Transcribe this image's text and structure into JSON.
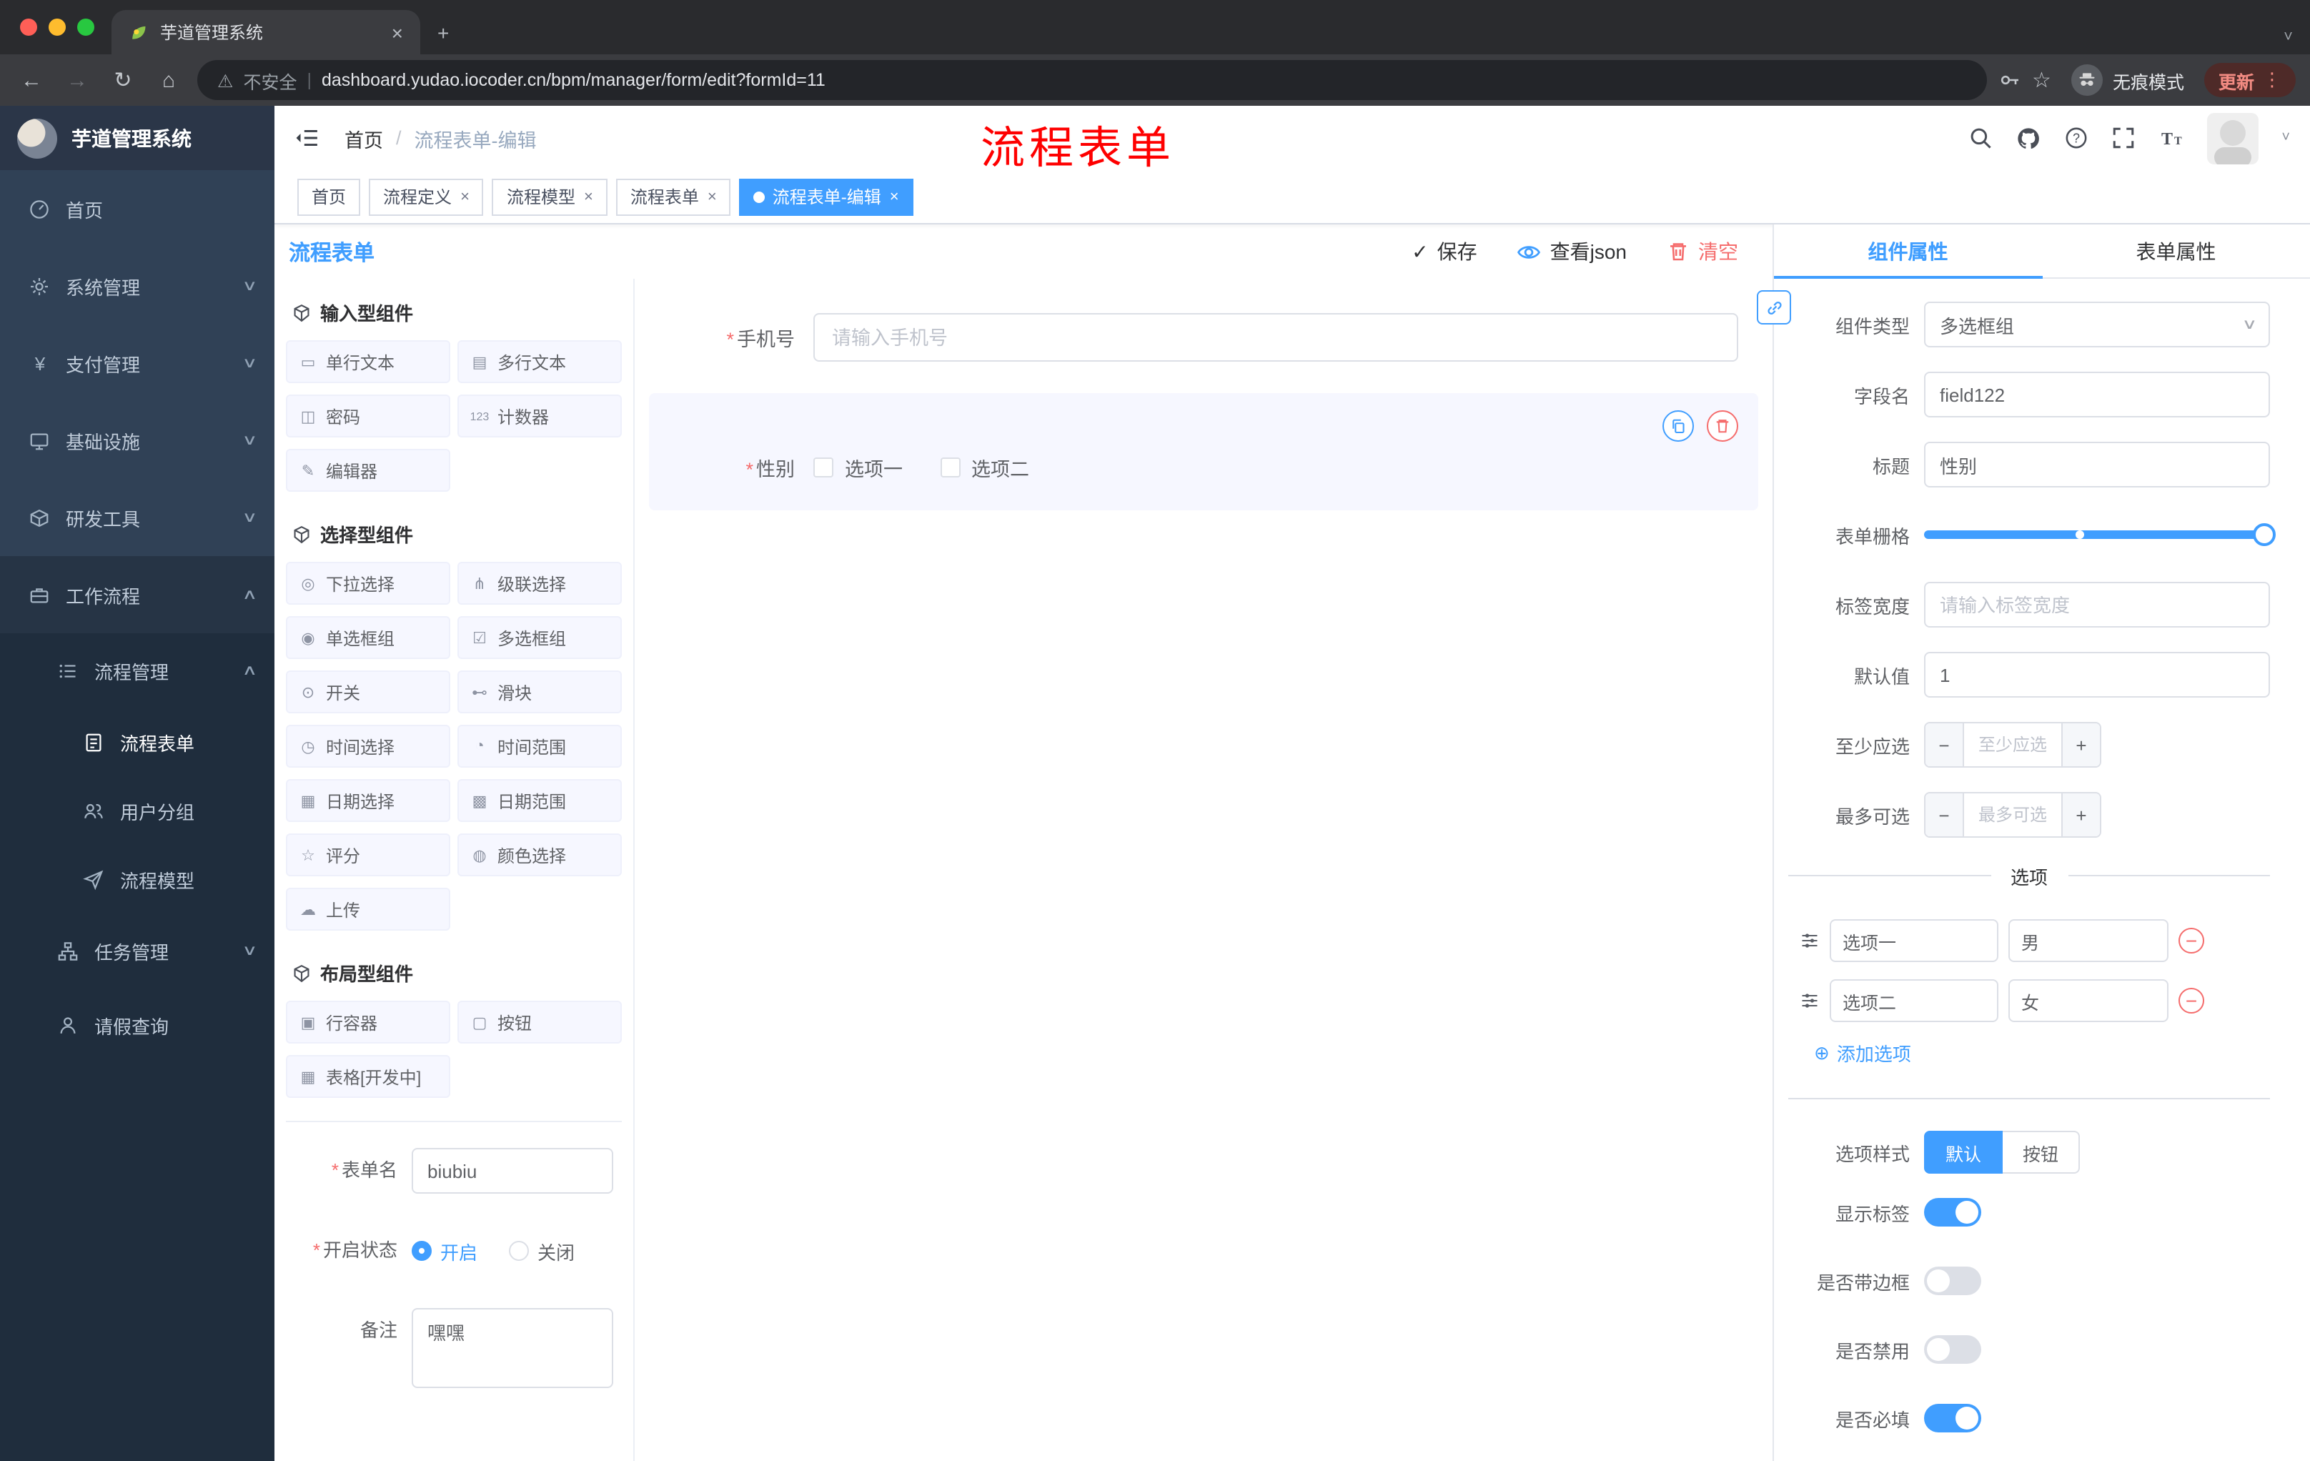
{
  "colors": {
    "primary": "#409eff",
    "danger": "#f56c6c",
    "sidebar_bg": "#304156",
    "sidebar_submenu_bg": "#1f2d3d",
    "nav_tab_active_bg": "#409eff",
    "annotation_red": "#fe0000",
    "update_pill_red": "#f28b82"
  },
  "icons": {
    "close": "×",
    "new_tab": "+",
    "back": "←",
    "forward": "→",
    "reload": "↻",
    "home": "⌂",
    "warning": "⚠",
    "star": "☆",
    "menu_dots": "⋮",
    "caret_down": "˅",
    "divider": "|",
    "check": "✓",
    "slash": "/",
    "chev_down": "∨",
    "chev_up": "∧",
    "required": "*",
    "minus": "−",
    "plus": "+",
    "add_circle": "⊕",
    "yen": "¥"
  },
  "browser": {
    "tab_title": "芋道管理系统",
    "security_label": "不安全",
    "url": "dashboard.yudao.iocoder.cn/bpm/manager/form/edit?formId=11",
    "incognito_label": "无痕模式",
    "update_label": "更新"
  },
  "annotation": {
    "text": "流程表单"
  },
  "app_header": {
    "breadcrumb_home": "首页",
    "breadcrumb_current": "流程表单-编辑"
  },
  "nav_tabs": [
    {
      "label": "首页"
    },
    {
      "label": "流程定义"
    },
    {
      "label": "流程模型"
    },
    {
      "label": "流程表单"
    },
    {
      "label": "流程表单-编辑"
    }
  ],
  "sidebar": {
    "logo_title": "芋道管理系统",
    "items": [
      {
        "label": "首页"
      },
      {
        "label": "系统管理"
      },
      {
        "label": "支付管理"
      },
      {
        "label": "基础设施"
      },
      {
        "label": "研发工具"
      },
      {
        "label": "工作流程"
      },
      {
        "label": "流程管理"
      },
      {
        "label": "流程表单"
      },
      {
        "label": "用户分组"
      },
      {
        "label": "流程模型"
      },
      {
        "label": "任务管理"
      },
      {
        "label": "请假查询"
      }
    ]
  },
  "page": {
    "title": "流程表单",
    "save": "保存",
    "view_json": "查看json",
    "clear": "清空"
  },
  "palette": {
    "groups": [
      {
        "title": "输入型组件",
        "items": [
          {
            "icon": "▭",
            "label": "单行文本"
          },
          {
            "icon": "▤",
            "label": "多行文本"
          },
          {
            "icon": "◫",
            "label": "密码"
          },
          {
            "icon": "123",
            "label": "计数器"
          },
          {
            "icon": "✎",
            "label": "编辑器"
          }
        ]
      },
      {
        "title": "选择型组件",
        "items": [
          {
            "icon": "◎",
            "label": "下拉选择"
          },
          {
            "icon": "⋔",
            "label": "级联选择"
          },
          {
            "icon": "◉",
            "label": "单选框组"
          },
          {
            "icon": "☑",
            "label": "多选框组"
          },
          {
            "icon": "⊙",
            "label": "开关"
          },
          {
            "icon": "⊷",
            "label": "滑块"
          },
          {
            "icon": "◷",
            "label": "时间选择"
          },
          {
            "icon": "◔",
            "label": "时间范围"
          },
          {
            "icon": "▦",
            "label": "日期选择"
          },
          {
            "icon": "▩",
            "label": "日期范围"
          },
          {
            "icon": "☆",
            "label": "评分"
          },
          {
            "icon": "◍",
            "label": "颜色选择"
          },
          {
            "icon": "☁",
            "label": "上传"
          }
        ]
      },
      {
        "title": "布局型组件",
        "items": [
          {
            "icon": "▣",
            "label": "行容器"
          },
          {
            "icon": "▢",
            "label": "按钮"
          },
          {
            "icon": "▦",
            "label": "表格[开发中]"
          }
        ]
      }
    ],
    "form": {
      "name_label": "表单名",
      "name_value": "biubiu",
      "status_label": "开启状态",
      "status_on": "开启",
      "status_off": "关闭",
      "remark_label": "备注",
      "remark_value": "嘿嘿"
    }
  },
  "canvas": {
    "phone_label": "手机号",
    "phone_placeholder": "请输入手机号",
    "gender_label": "性别",
    "gender_option1": "选项一",
    "gender_option2": "选项二"
  },
  "props": {
    "tab_component": "组件属性",
    "tab_form": "表单属性",
    "type_label": "组件类型",
    "type_value": "多选框组",
    "field_label": "字段名",
    "field_value": "field122",
    "title_label": "标题",
    "title_value": "性别",
    "grid_label": "表单栅格",
    "width_label": "标签宽度",
    "width_placeholder": "请输入标签宽度",
    "default_label": "默认值",
    "default_value": "1",
    "min_label": "至少应选",
    "min_placeholder": "至少应选",
    "max_label": "最多可选",
    "max_placeholder": "最多可选",
    "options_title": "选项",
    "options": [
      {
        "name": "选项一",
        "value": "男"
      },
      {
        "name": "选项二",
        "value": "女"
      }
    ],
    "add_option": "添加选项",
    "style_label": "选项样式",
    "style_default": "默认",
    "style_button": "按钮",
    "switch_show_label": "显示标签",
    "switch_border": "是否带边框",
    "switch_disabled": "是否禁用",
    "switch_required": "是否必填"
  }
}
